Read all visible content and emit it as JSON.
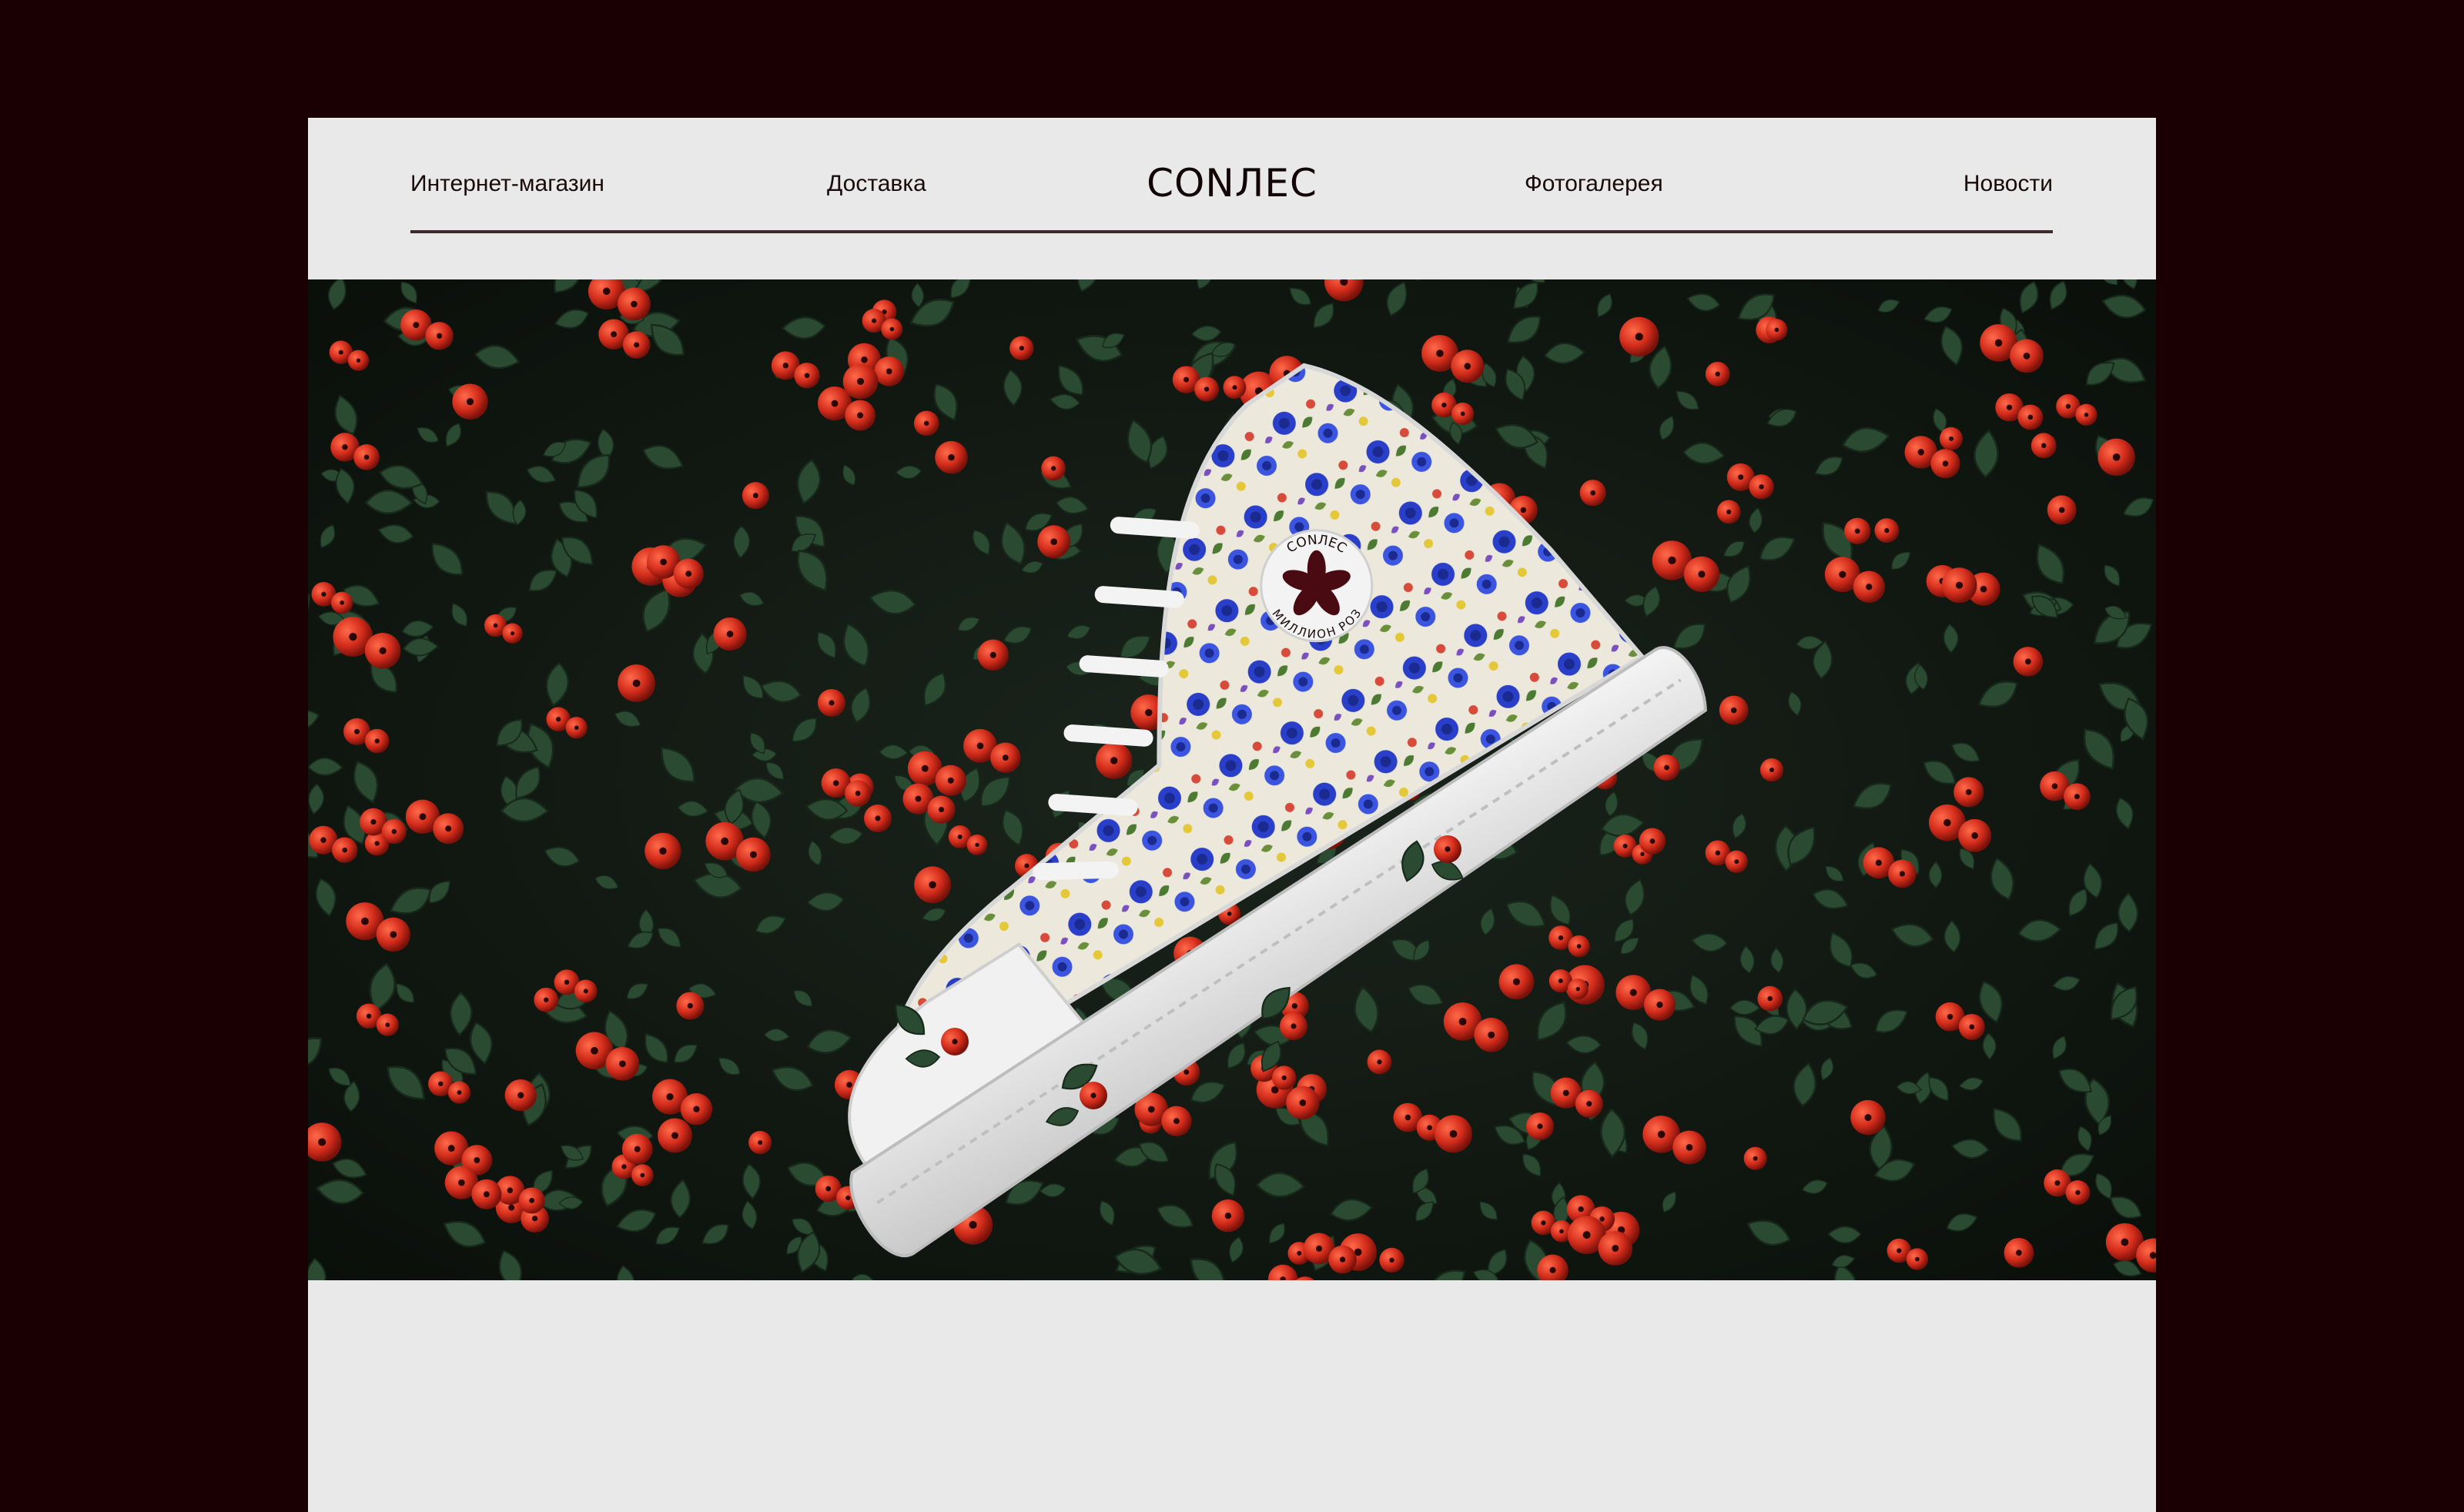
{
  "nav": {
    "shop": "Интернет-магазин",
    "delivery": "Доставка",
    "logo": "CONЛЕС",
    "gallery": "Фотогалерея",
    "news": "Новости"
  },
  "hero": {
    "badge_top": "CONЛЕС",
    "badge_bottom": "МИЛЛИОН РОЗ",
    "image_subject": "high-top sneaker with floral pattern among red berries"
  },
  "colors": {
    "background": "#1a0003",
    "page": "#e9e9e9",
    "text": "#1a0a0c",
    "berry": "#d6301f",
    "leaf": "#24402b",
    "rose_blue": "#2a3fc9",
    "badge_flower": "#4a0a12"
  }
}
